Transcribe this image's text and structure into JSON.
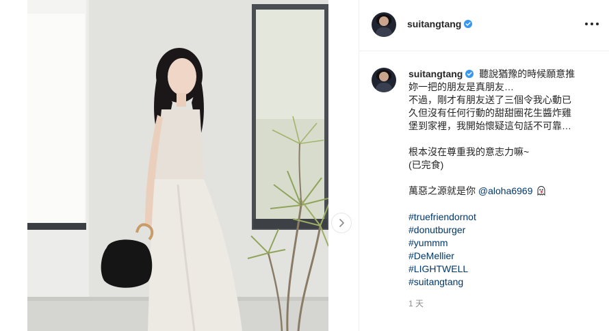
{
  "post": {
    "username": "suitangtang",
    "more_icon": "more-horizontal-icon",
    "verified_icon": "verified-badge-icon",
    "next_icon": "chevron-right-icon"
  },
  "caption": {
    "username": "suitangtang",
    "lines": [
      "聽說猶豫的時候願意推",
      "妳一把的朋友是真朋友…",
      "不過，剛才有朋友送了三個令我心動已",
      "久但沒有任何行動的甜甜圈花生醬炸雞",
      "堡到家裡，我開始懷疑這句話不可靠…"
    ],
    "line_2": "根本沒在尊重我的意志力嘛~",
    "line_3": "(已完食)",
    "blame_text": "萬惡之源就是你",
    "mention": "@aloha6969",
    "emoji_icon": "ghost-emoji-icon",
    "hashtags": [
      "#truefriendornot",
      "#donutburger",
      "#yummm",
      "#DeMellier",
      "#LIGHTWELL",
      "#suitangtang"
    ],
    "timestamp": "1 天"
  },
  "colors": {
    "link": "#00376b",
    "verified": "#3897f0",
    "text": "#262626",
    "muted": "#8e8e8e"
  }
}
